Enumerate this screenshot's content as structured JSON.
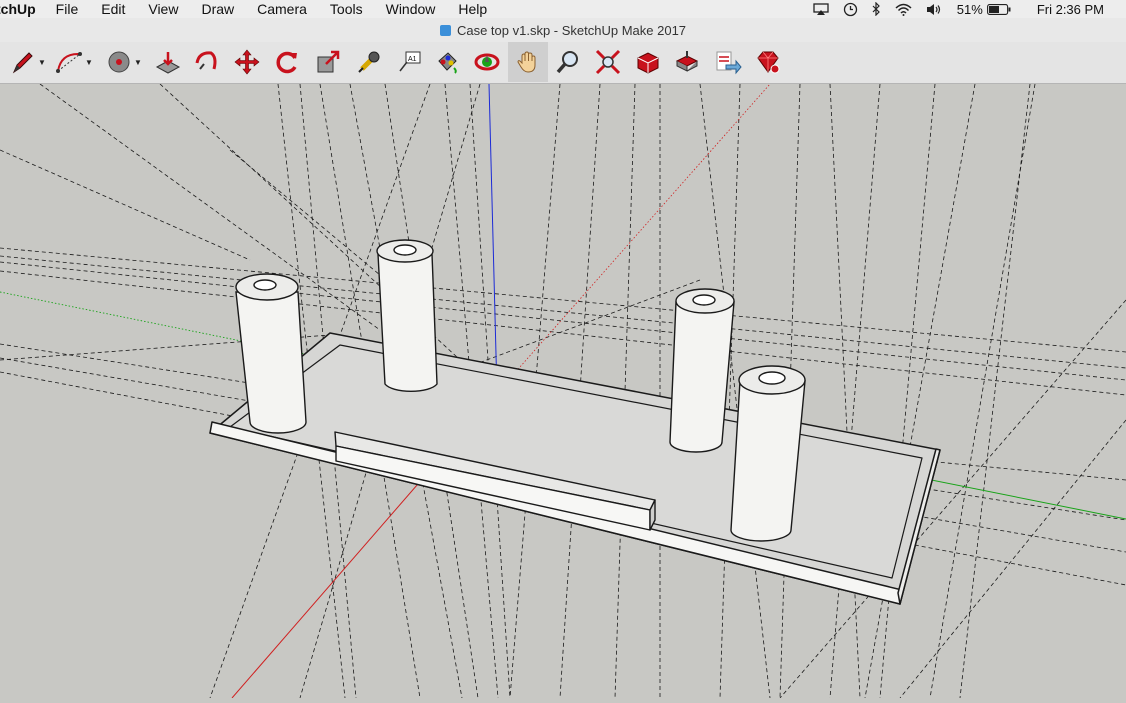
{
  "menubar": {
    "app_name": "tchUp",
    "items": [
      "File",
      "Edit",
      "View",
      "Draw",
      "Camera",
      "Tools",
      "Window",
      "Help"
    ],
    "battery": "51%",
    "clock": "Fri 2:36 PM"
  },
  "window": {
    "title": "Case top v1.skp - SketchUp Make 2017"
  },
  "toolbar": {
    "tools": [
      {
        "name": "pencil-tool",
        "icon": "pencil-icon",
        "dropdown": true
      },
      {
        "name": "arc-tool",
        "icon": "arc-icon",
        "dropdown": true
      },
      {
        "name": "circle-tool",
        "icon": "circle-icon",
        "dropdown": true
      },
      {
        "name": "push-pull-tool",
        "icon": "push-pull-icon"
      },
      {
        "name": "follow-me-tool",
        "icon": "follow-me-icon"
      },
      {
        "name": "move-tool",
        "icon": "move-icon"
      },
      {
        "name": "rotate-tool",
        "icon": "rotate-icon"
      },
      {
        "name": "scale-tool",
        "icon": "scale-icon"
      },
      {
        "name": "tape-measure-tool",
        "icon": "tape-measure-icon"
      },
      {
        "name": "text-tool",
        "icon": "text-icon",
        "label": "A1"
      },
      {
        "name": "paint-bucket-tool",
        "icon": "paint-bucket-icon"
      },
      {
        "name": "orbit-tool",
        "icon": "orbit-icon"
      },
      {
        "name": "pan-tool",
        "icon": "hand-icon",
        "active": true
      },
      {
        "name": "zoom-tool",
        "icon": "magnifier-icon"
      },
      {
        "name": "zoom-extents-tool",
        "icon": "zoom-extents-icon"
      },
      {
        "name": "warehouse-tool",
        "icon": "3d-warehouse-icon"
      },
      {
        "name": "share-model-tool",
        "icon": "share-model-icon"
      },
      {
        "name": "extension-warehouse-tool",
        "icon": "extension-warehouse-icon"
      },
      {
        "name": "send-to-layout-tool",
        "icon": "send-to-layout-icon"
      },
      {
        "name": "ruby-console-tool",
        "icon": "ruby-icon"
      }
    ]
  },
  "colors": {
    "background": "#c8c8c4",
    "axis_red": "#d02020",
    "axis_green": "#19a319",
    "axis_blue": "#1c2bd6",
    "icon_red": "#c8121d"
  }
}
